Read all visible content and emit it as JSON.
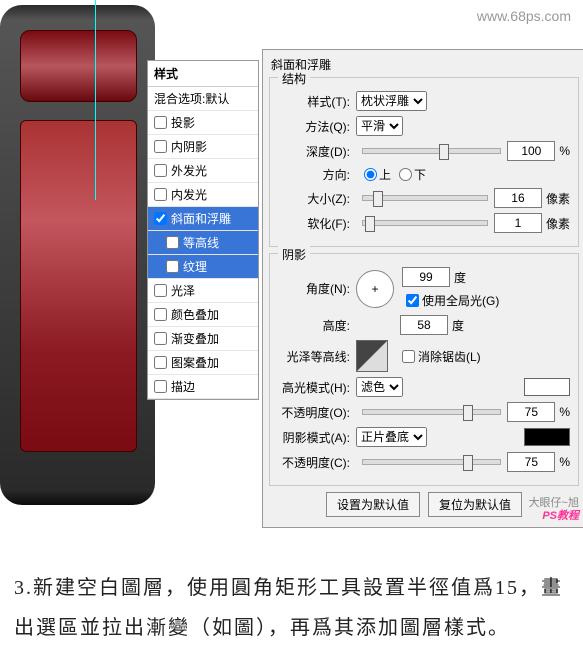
{
  "watermark": "www.68ps.com",
  "styles_panel": {
    "header": "样式",
    "blend_defaults": "混合选项:默认",
    "items": [
      {
        "label": "投影",
        "checked": false,
        "sel": false
      },
      {
        "label": "内阴影",
        "checked": false,
        "sel": false
      },
      {
        "label": "外发光",
        "checked": false,
        "sel": false
      },
      {
        "label": "内发光",
        "checked": false,
        "sel": false
      },
      {
        "label": "斜面和浮雕",
        "checked": true,
        "sel": true
      },
      {
        "label": "等高线",
        "checked": false,
        "sel": true,
        "sub": true
      },
      {
        "label": "纹理",
        "checked": false,
        "sel": true,
        "sub": true
      },
      {
        "label": "光泽",
        "checked": false,
        "sel": false
      },
      {
        "label": "颜色叠加",
        "checked": false,
        "sel": false
      },
      {
        "label": "渐变叠加",
        "checked": false,
        "sel": false
      },
      {
        "label": "图案叠加",
        "checked": false,
        "sel": false
      },
      {
        "label": "描边",
        "checked": false,
        "sel": false
      }
    ]
  },
  "panel_title": "斜面和浮雕",
  "structure": {
    "title": "结构",
    "style_label": "样式(T):",
    "style_value": "枕状浮雕",
    "tech_label": "方法(Q):",
    "tech_value": "平滑",
    "depth_label": "深度(D):",
    "depth_value": "100",
    "depth_unit": "%",
    "dir_label": "方向:",
    "up": "上",
    "down": "下",
    "size_label": "大小(Z):",
    "size_value": "16",
    "size_unit": "像素",
    "soften_label": "软化(F):",
    "soften_value": "1",
    "soften_unit": "像素"
  },
  "shading": {
    "title": "阴影",
    "angle_label": "角度(N):",
    "angle_value": "99",
    "angle_unit": "度",
    "global_label": "使用全局光(G)",
    "alt_label": "高度:",
    "alt_value": "58",
    "alt_unit": "度",
    "contour_label": "光泽等高线:",
    "anti_label": "消除锯齿(L)",
    "hmode_label": "高光模式(H):",
    "hmode_value": "滤色",
    "hop_label": "不透明度(O):",
    "hop_value": "75",
    "hop_unit": "%",
    "smode_label": "阴影模式(A):",
    "smode_value": "正片叠底",
    "sop_label": "不透明度(C):",
    "sop_value": "75",
    "sop_unit": "%"
  },
  "buttons": {
    "default": "设置为默认值",
    "reset": "复位为默认值"
  },
  "wm2": {
    "l1": "大眼仔~旭",
    "l2": "PS教程"
  },
  "caption": "3.新建空白圖層，使用圓角矩形工具設置半徑值爲15，畫出選區並拉出漸變（如圖），再爲其添加圖層樣式。"
}
